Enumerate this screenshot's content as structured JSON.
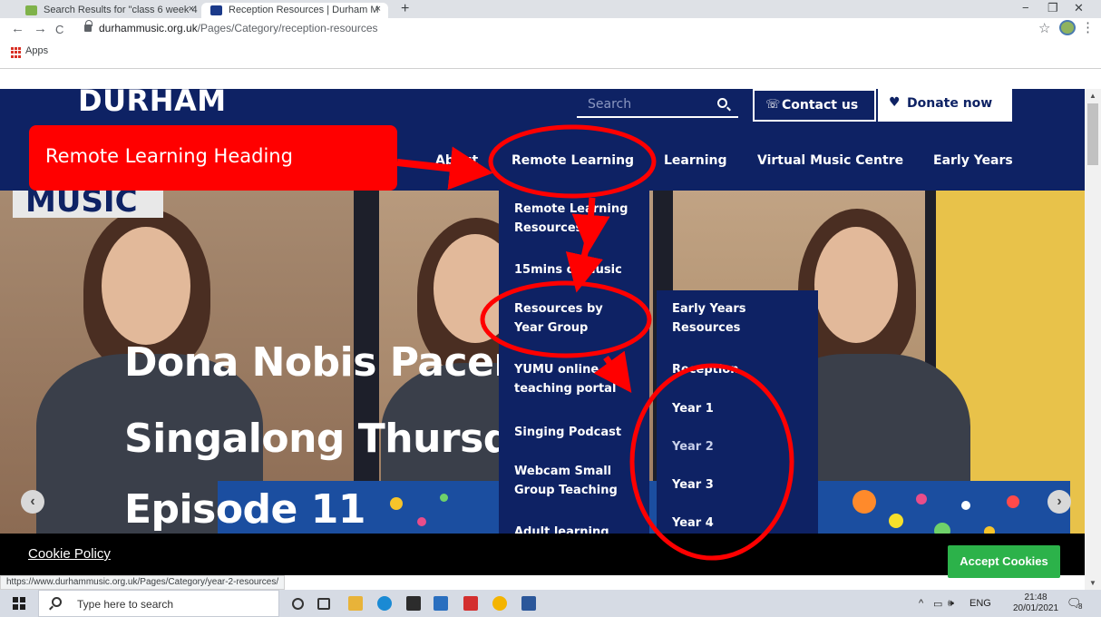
{
  "browser": {
    "tabs": [
      {
        "title": "Search Results for \"class 6 week 4",
        "close": "×"
      },
      {
        "title": "Reception Resources | Durham M",
        "close": "×"
      }
    ],
    "new_tab": "+",
    "window_controls": {
      "minimize": "−",
      "restore": "❐",
      "close": "✕"
    },
    "nav": {
      "back": "←",
      "forward": "→",
      "reload": "C"
    },
    "url_host": "durhammusic.org.uk",
    "url_path": "/Pages/Category/reception-resources",
    "bookmark_star": "☆",
    "menu": "⋮",
    "bookmarks_bar": {
      "apps_label": "Apps"
    },
    "status_url": "https://www.durhammusic.org.uk/Pages/Category/year-2-resources/"
  },
  "site": {
    "logo_top": "DURHAM",
    "logo_bottom": "MUSIC",
    "search_placeholder": "Search",
    "contact_label": "Contact us",
    "donate_label": "Donate now",
    "nav": {
      "about": "About",
      "remote_learning": "Remote Learning",
      "learning": "Learning",
      "virtual_music_centre": "Virtual Music Centre",
      "early_years": "Early Years"
    },
    "dropdown": [
      "Remote Learning\nResources",
      "15mins of Music",
      "Resources by\nYear Group",
      "YUMU online\nteaching portal",
      "Singing Podcast",
      "Webcam Small\nGroup Teaching",
      "Adult learning"
    ],
    "submenu": [
      "Early Years\nResources",
      "Reception",
      "Year 1",
      "Year 2",
      "Year 3",
      "Year 4"
    ],
    "hero_lines": [
      "Dona Nobis Pacem",
      "Singalong Thursday",
      "Episode 11"
    ],
    "carousel": {
      "prev": "‹",
      "next": "›"
    }
  },
  "annotation": {
    "callout": "Remote Learning Heading",
    "color": "#ff0000"
  },
  "cookie_bar": {
    "policy_link": "Cookie Policy",
    "accept_button": "Accept Cookies"
  },
  "taskbar": {
    "search_placeholder": "Type here to search",
    "language": "ENG",
    "time": "21:48",
    "date": "20/01/2021",
    "notification_count": "8"
  }
}
